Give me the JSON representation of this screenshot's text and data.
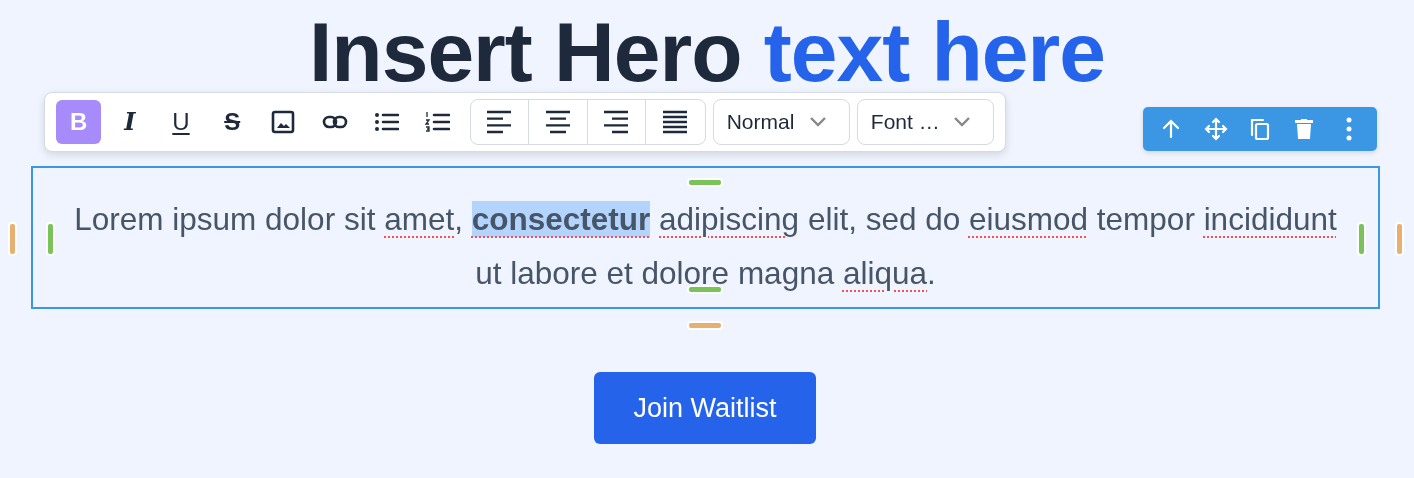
{
  "heading": {
    "main": "Insert Hero",
    "accent": "text here"
  },
  "format_buttons": [
    {
      "kind": "bold",
      "label": "B",
      "selected": true
    },
    {
      "kind": "italic",
      "label": "I",
      "selected": false
    },
    {
      "kind": "underline",
      "label": "U",
      "selected": false
    },
    {
      "kind": "strike",
      "label": "S",
      "selected": false
    },
    {
      "kind": "image",
      "selected": false
    },
    {
      "kind": "link",
      "selected": false
    },
    {
      "kind": "bullets",
      "selected": false
    },
    {
      "kind": "numbers",
      "selected": false
    }
  ],
  "align_buttons": [
    {
      "kind": "left"
    },
    {
      "kind": "center"
    },
    {
      "kind": "right"
    },
    {
      "kind": "justify"
    }
  ],
  "dropdowns": [
    {
      "value": "Normal"
    },
    {
      "value": "Font …"
    }
  ],
  "block_actions": [
    {
      "kind": "up"
    },
    {
      "kind": "move"
    },
    {
      "kind": "copy"
    },
    {
      "kind": "delete"
    },
    {
      "kind": "more"
    }
  ],
  "paragraph": [
    {
      "text": "Lorem ipsum dolor sit ",
      "bold": false,
      "highlighted": false,
      "misspelled": false
    },
    {
      "text": "amet",
      "bold": false,
      "highlighted": false,
      "misspelled": true
    },
    {
      "text": ", ",
      "bold": false,
      "highlighted": false,
      "misspelled": false
    },
    {
      "text": "consectetur",
      "bold": true,
      "highlighted": true,
      "misspelled": true
    },
    {
      "text": " adipiscing",
      "bold": false,
      "highlighted": false,
      "misspelled": true
    },
    {
      "text": " elit, sed do ",
      "bold": false,
      "highlighted": false,
      "misspelled": false
    },
    {
      "text": "eiusmod",
      "bold": false,
      "highlighted": false,
      "misspelled": true
    },
    {
      "text": " tempor ",
      "bold": false,
      "highlighted": false,
      "misspelled": false
    },
    {
      "text": "incididunt",
      "bold": false,
      "highlighted": false,
      "misspelled": true
    },
    {
      "text": " ut labore et dolore magna ",
      "bold": false,
      "highlighted": false,
      "misspelled": false
    },
    {
      "text": "aliqua",
      "bold": false,
      "highlighted": false,
      "misspelled": true
    },
    {
      "text": ".",
      "bold": false,
      "highlighted": false,
      "misspelled": false
    }
  ],
  "cta_button": "Join Waitlist"
}
